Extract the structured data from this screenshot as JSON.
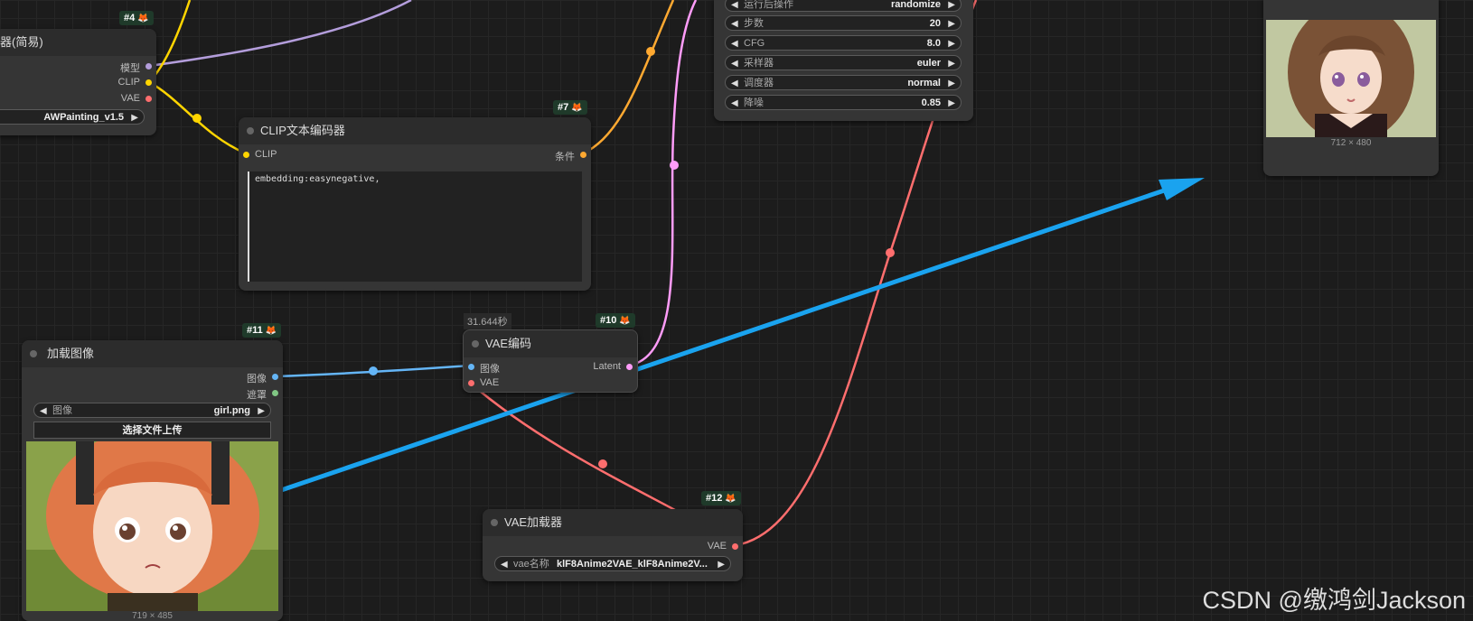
{
  "canvas": {
    "watermark": "CSDN @缴鸿剑Jackson"
  },
  "node4": {
    "id_badge": "#4",
    "title": "器(简易)",
    "outputs": [
      "模型",
      "CLIP",
      "VAE"
    ],
    "widget_value": "AWPainting_v1.5"
  },
  "sampler_node": {
    "widgets": [
      {
        "label": "运行后操作",
        "value": "randomize"
      },
      {
        "label": "步数",
        "value": "20"
      },
      {
        "label": "CFG",
        "value": "8.0"
      },
      {
        "label": "采样器",
        "value": "euler"
      },
      {
        "label": "调度器",
        "value": "normal"
      },
      {
        "label": "降噪",
        "value": "0.85"
      }
    ]
  },
  "preview_node": {
    "dims": "712 × 480"
  },
  "node7": {
    "id_badge": "#7",
    "title": "CLIP文本编码器",
    "input": "CLIP",
    "output": "条件",
    "text": "embedding:easynegative,"
  },
  "node10": {
    "id_badge": "#10",
    "timer": "31.644秒",
    "title": "VAE编码",
    "inputs": [
      "图像",
      "VAE"
    ],
    "output": "Latent"
  },
  "node11": {
    "id_badge": "#11",
    "title": "加载图像",
    "outputs": [
      "图像",
      "遮罩"
    ],
    "widget_label": "图像",
    "widget_value": "girl.png",
    "upload_button": "选择文件上传",
    "dims": "719 × 485"
  },
  "node12": {
    "id_badge": "#12",
    "title": "VAE加载器",
    "output": "VAE",
    "widget_label": "vae名称",
    "widget_value": "klF8Anime2VAE_klF8Anime2V..."
  },
  "colors": {
    "model_wire": "#b39ddb",
    "clip_wire": "#ffd500",
    "vae_wire": "#ff6e6e",
    "cond_wire": "#ffa931",
    "latent_wire": "#ff9cf9",
    "image_wire": "#64b5f6",
    "mask_port": "#81c784",
    "arrow": "#1aa3ef"
  }
}
